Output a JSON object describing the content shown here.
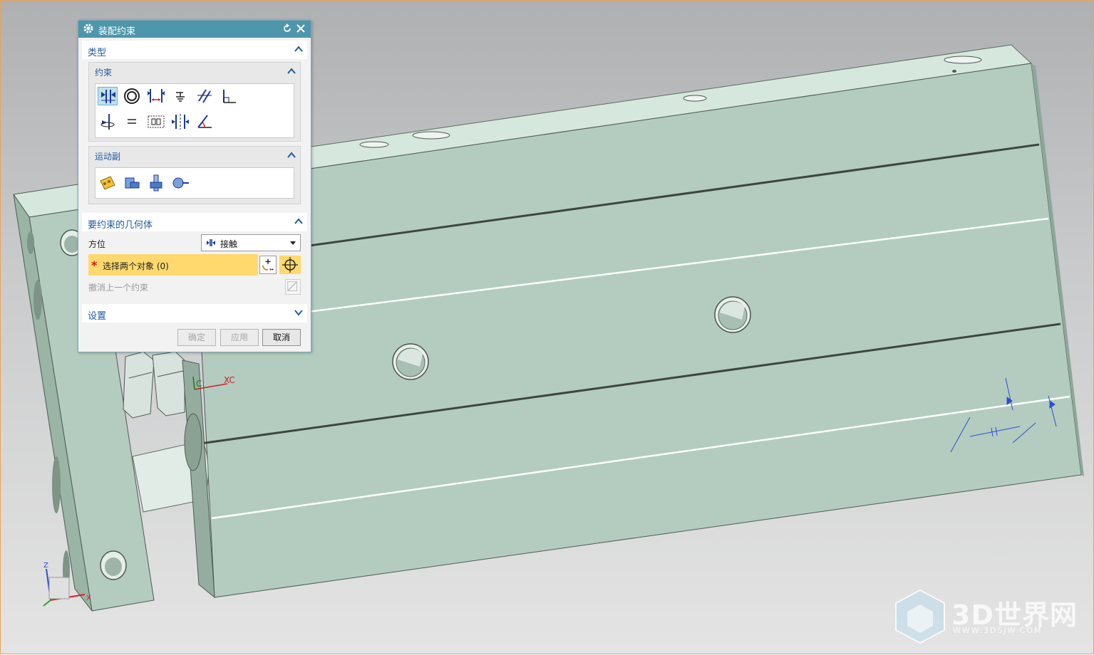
{
  "dialog": {
    "title": "装配约束",
    "sections": {
      "type": "类型",
      "geometry": "要约束的几何体",
      "settings": "设置"
    },
    "groups": {
      "constraints": "约束",
      "motion": "运动副"
    },
    "orientation": {
      "label": "方位",
      "value": "接触"
    },
    "select_objects": "选择两个对象 (0)",
    "undo_last": "撤消上一个约束",
    "buttons": {
      "ok": "确定",
      "apply": "应用",
      "cancel": "取消"
    }
  },
  "viewport": {
    "axes": {
      "x": "XC",
      "c": "C"
    },
    "triad": {
      "z": "Z",
      "x": "X"
    }
  },
  "watermark": {
    "brand": "3D世界网",
    "url": "WWW.3DSJW.COM"
  },
  "colors": {
    "titlebar": "#4d96ab",
    "model_face": "#b5cec1",
    "model_top": "#d3e5db",
    "highlight": "#ffd96e",
    "header_text": "#1f5a9e"
  }
}
